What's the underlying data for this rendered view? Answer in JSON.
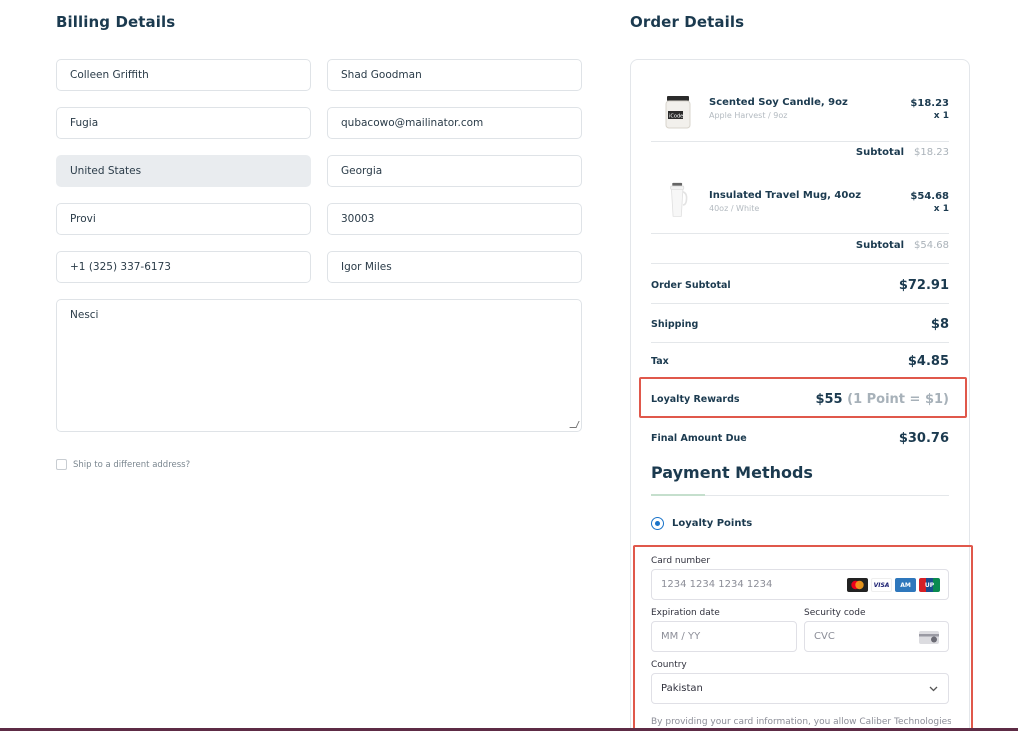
{
  "billing": {
    "title": "Billing Details",
    "first_name": "Colleen Griffith",
    "last_name": "Shad Goodman",
    "company": "Fugia",
    "email": "qubacowo@mailinator.com",
    "country": "United States",
    "state": "Georgia",
    "city": "Provi",
    "zip": "30003",
    "phone": "+1 (325) 337-6173",
    "address": "Igor Miles",
    "notes": "Nesci",
    "ship_different": "Ship to a different address?"
  },
  "order": {
    "title": "Order Details",
    "items": [
      {
        "name": "Scented Soy Candle, 9oz",
        "variant": "Apple Harvest / 9oz",
        "price": "$18.23",
        "qty": "x 1",
        "subtotal_label": "Subtotal",
        "subtotal": "$18.23",
        "thumb_icon": "candle-jar-icon"
      },
      {
        "name": "Insulated Travel Mug, 40oz",
        "variant": "40oz / White",
        "price": "$54.68",
        "qty": "x 1",
        "subtotal_label": "Subtotal",
        "subtotal": "$54.68",
        "thumb_icon": "travel-mug-icon"
      }
    ],
    "order_subtotal_label": "Order Subtotal",
    "order_subtotal": "$72.91",
    "shipping_label": "Shipping",
    "shipping": "$8",
    "tax_label": "Tax",
    "tax": "$4.85",
    "loyalty_label": "Loyalty Rewards",
    "loyalty_value": "$55",
    "loyalty_rate": "(1 Point = $1)",
    "final_label": "Final Amount Due",
    "final": "$30.76"
  },
  "payment": {
    "title": "Payment Methods",
    "method": "Loyalty Points",
    "card_number_label": "Card number",
    "card_number_placeholder": "1234 1234 1234 1234",
    "expiry_label": "Expiration date",
    "expiry_placeholder": "MM / YY",
    "cvc_label": "Security code",
    "cvc_placeholder": "CVC",
    "country_label": "Country",
    "country": "Pakistan",
    "fine_print": "By providing your card information, you allow Caliber Technologies",
    "card_brands": [
      "mastercard-icon",
      "visa-icon",
      "amex-icon",
      "unionpay-icon"
    ]
  },
  "colors": {
    "highlight": "#e0584b",
    "accent": "#1a73c9",
    "heading": "#1b3a4f"
  }
}
